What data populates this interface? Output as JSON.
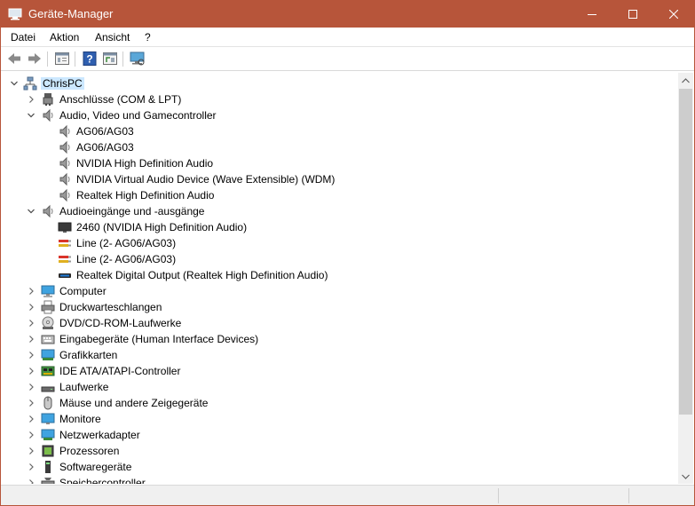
{
  "window": {
    "title": "Geräte-Manager",
    "accent_color": "#b7553a"
  },
  "menu": {
    "items": [
      "Datei",
      "Aktion",
      "Ansicht",
      "?"
    ]
  },
  "toolbar": {
    "buttons": [
      "back-arrow-icon",
      "forward-arrow-icon",
      "properties-icon",
      "help-icon",
      "update-driver-icon",
      "scan-hardware-icon"
    ]
  },
  "tree": {
    "root": "ChrisPC",
    "nodes": [
      {
        "label": "Anschlüsse (COM & LPT)",
        "expanded": false,
        "icon": "port-icon"
      },
      {
        "label": "Audio, Video und Gamecontroller",
        "expanded": true,
        "icon": "speaker-icon",
        "children": [
          "AG06/AG03",
          "AG06/AG03",
          "NVIDIA High Definition Audio",
          "NVIDIA Virtual Audio Device (Wave Extensible) (WDM)",
          "Realtek High Definition Audio"
        ]
      },
      {
        "label": "Audioeingänge und -ausgänge",
        "expanded": true,
        "icon": "speaker-icon",
        "children": [
          "2460 (NVIDIA High Definition Audio)",
          "Line (2- AG06/AG03)",
          "Line (2- AG06/AG03)",
          "Realtek Digital Output (Realtek High Definition Audio)"
        ]
      },
      {
        "label": "Computer",
        "expanded": false,
        "icon": "computer-icon"
      },
      {
        "label": "Druckwarteschlangen",
        "expanded": false,
        "icon": "printer-icon"
      },
      {
        "label": "DVD/CD-ROM-Laufwerke",
        "expanded": false,
        "icon": "disc-icon"
      },
      {
        "label": "Eingabegeräte (Human Interface Devices)",
        "expanded": false,
        "icon": "keyboard-icon"
      },
      {
        "label": "Grafikkarten",
        "expanded": false,
        "icon": "display-adapter-icon"
      },
      {
        "label": "IDE ATA/ATAPI-Controller",
        "expanded": false,
        "icon": "ide-controller-icon"
      },
      {
        "label": "Laufwerke",
        "expanded": false,
        "icon": "drive-icon"
      },
      {
        "label": "Mäuse und andere Zeigegeräte",
        "expanded": false,
        "icon": "mouse-icon"
      },
      {
        "label": "Monitore",
        "expanded": false,
        "icon": "monitor-icon"
      },
      {
        "label": "Netzwerkadapter",
        "expanded": false,
        "icon": "network-adapter-icon"
      },
      {
        "label": "Prozessoren",
        "expanded": false,
        "icon": "processor-icon"
      },
      {
        "label": "Softwaregeräte",
        "expanded": false,
        "icon": "software-device-icon"
      },
      {
        "label": "Speichercontroller",
        "expanded": false,
        "icon": "storage-controller-icon"
      }
    ]
  }
}
